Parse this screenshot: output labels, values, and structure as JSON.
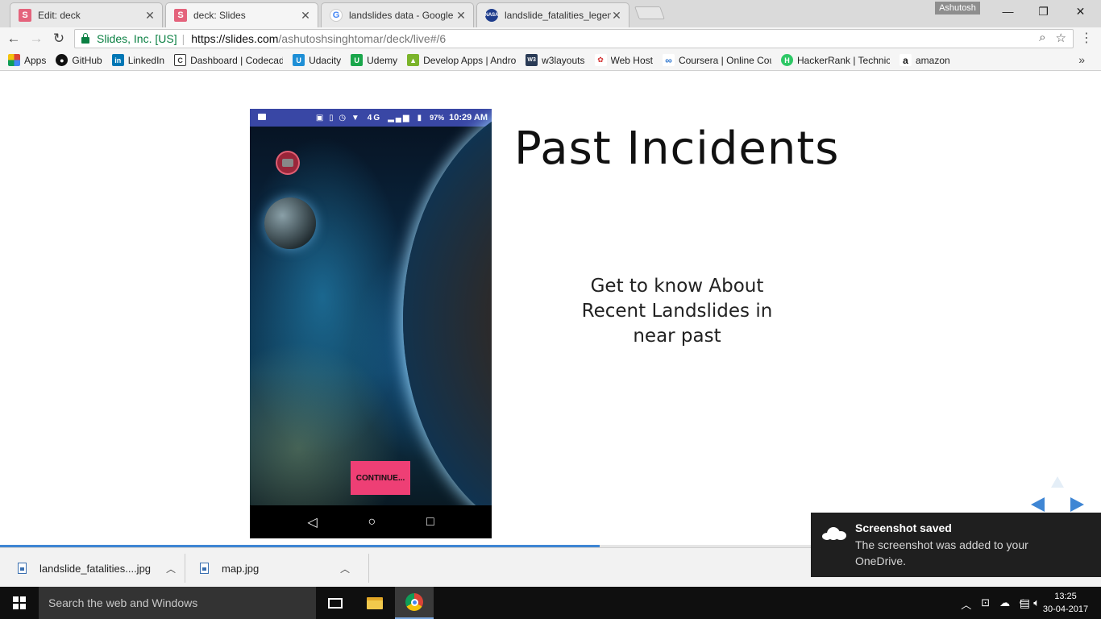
{
  "tabs": [
    {
      "label": "Edit: deck",
      "favicon": "S"
    },
    {
      "label": "deck: Slides",
      "favicon": "S"
    },
    {
      "label": "landslides data - Google",
      "favicon": "G"
    },
    {
      "label": "landslide_fatalities_legen",
      "favicon": "NASA"
    }
  ],
  "window": {
    "profile": "Ashutosh"
  },
  "omnibox": {
    "security_label": "Slides, Inc. [US]",
    "url_main": "https://slides.com",
    "url_path": "/ashutoshsinghtomar/deck/live#/6"
  },
  "bookmarks": [
    {
      "label": "Apps",
      "icon": "apps-grid-icon"
    },
    {
      "label": "GitHub",
      "icon": "github-icon"
    },
    {
      "label": "LinkedIn",
      "icon": "linkedin-icon"
    },
    {
      "label": "Dashboard | Codecad",
      "icon": "codecademy-icon"
    },
    {
      "label": "Udacity",
      "icon": "udacity-icon"
    },
    {
      "label": "Udemy",
      "icon": "udemy-icon"
    },
    {
      "label": "Develop Apps | Andro",
      "icon": "android-icon"
    },
    {
      "label": "w3layouts",
      "icon": "w3layouts-icon"
    },
    {
      "label": "Web Host",
      "icon": "webhost-icon"
    },
    {
      "label": "Coursera | Online Cou",
      "icon": "coursera-icon"
    },
    {
      "label": "HackerRank | Technica",
      "icon": "hackerrank-icon"
    },
    {
      "label": "amazon",
      "icon": "amazon-icon"
    }
  ],
  "phone": {
    "battery": "97%",
    "network": "4G",
    "time": "10:29 AM",
    "continue_label": "CONTINUE..."
  },
  "slide": {
    "title": "Past Incidents",
    "body": "Get to know About Recent Landslides in near past",
    "progress": 0.545
  },
  "downloads": [
    {
      "filename": "landslide_fatalities....jpg"
    },
    {
      "filename": "map.jpg"
    }
  ],
  "toast": {
    "title": "Screenshot saved",
    "body": "The screenshot was added to your OneDrive."
  },
  "taskbar": {
    "search_placeholder": "Search the web and Windows",
    "time": "13:25",
    "date": "30-04-2017"
  },
  "colors": {
    "slides_accent": "#e4637c",
    "continue_button": "#ee3f75",
    "status_bar": "#3947a5",
    "slide_controls": "#3f86d4",
    "secure_green": "#0b8043"
  }
}
